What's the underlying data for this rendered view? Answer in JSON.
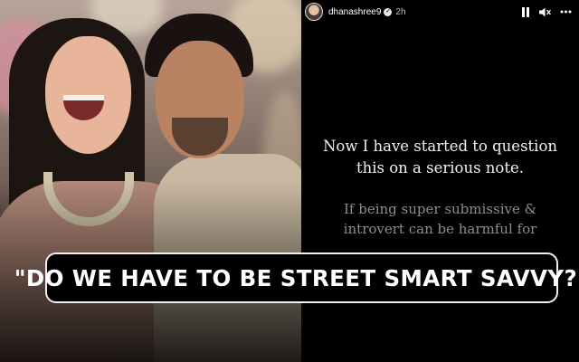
{
  "story": {
    "username": "dhanashree9",
    "time": "2h",
    "lines_main": [
      "Now I have started to question",
      "this on a serious note."
    ],
    "lines_dim": [
      "If being super submissive &",
      "introvert can be harmful for"
    ],
    "controls": {
      "pause_icon": "pause-icon",
      "mute_icon": "mute-icon",
      "more_icon": "more-icon"
    },
    "verified_icon": "verified-badge-icon"
  },
  "banner": {
    "headline": "\"DO WE HAVE TO BE STREET SMART SAVVY?\""
  },
  "colors": {
    "banner_border": "#f0f0f0",
    "story_background": "#000000",
    "text_main": "#f2f2f2",
    "text_dim": "#8d8d8d"
  }
}
